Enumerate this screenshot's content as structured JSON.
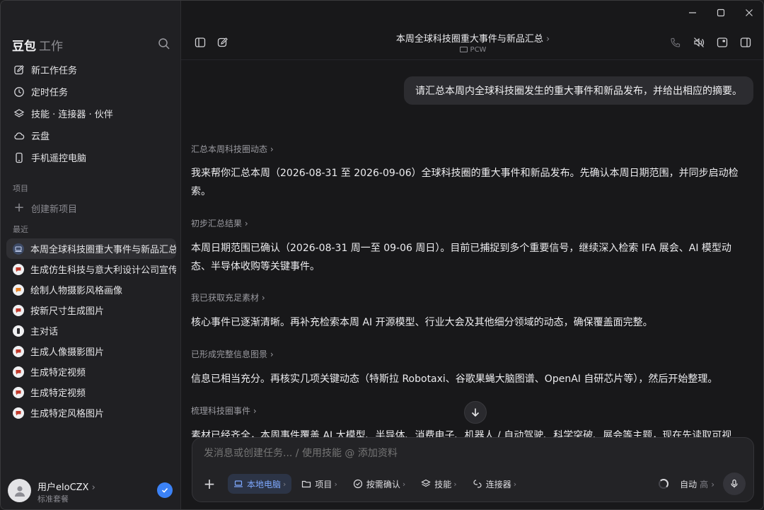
{
  "sidebar": {
    "brand": "豆包",
    "brand_sub": "工作",
    "menu": [
      {
        "label": "新工作任务"
      },
      {
        "label": "定时任务"
      },
      {
        "label": "技能 · 连接器 · 伙伴"
      },
      {
        "label": "云盘"
      },
      {
        "label": "手机遥控电脑"
      }
    ],
    "projects_label": "项目",
    "new_project": "创建新项目",
    "recent_label": "最近",
    "recent": [
      {
        "label": "本周全球科技圈重大事件与新品汇总"
      },
      {
        "label": "生成仿生科技与意大利设计公司宣传"
      },
      {
        "label": "绘制人物摄影风格画像"
      },
      {
        "label": "按新尺寸生成图片"
      },
      {
        "label": "主对话"
      },
      {
        "label": "生成人像摄影图片"
      },
      {
        "label": "生成特定视频"
      },
      {
        "label": "生成特定视频"
      },
      {
        "label": "生成特定风格图片"
      }
    ],
    "user": {
      "name": "用户eloCZX",
      "plan": "标准套餐"
    }
  },
  "header": {
    "title": "本周全球科技圈重大事件与新品汇总",
    "subtitle": "PCW"
  },
  "conversation": {
    "user_message": "请汇总本周内全球科技圈发生的重大事件和新品发布，并给出相应的摘要。",
    "steps": [
      {
        "title": "汇总本周科技圈动态",
        "text": "我来帮你汇总本周（2026-08-31 至 2026-09-06）全球科技圈的重大事件和新品发布。先确认本周日期范围，并同步启动检索。"
      },
      {
        "title": "初步汇总结果",
        "text": "本周日期范围已确认（2026-08-31 周一至 09-06 周日）。目前已捕捉到多个重要信号，继续深入检索 IFA 展会、AI 模型动态、半导体收购等关键事件。"
      },
      {
        "title": "我已获取充足素材",
        "text": "核心事件已逐渐清晰。再补充检索本周 AI 开源模型、行业大会及其他细分领域的动态，确保覆盖面完整。"
      },
      {
        "title": "已形成完整信息图景",
        "text": "信息已相当充分。再核实几项关键动态（特斯拉 Robotaxi、谷歌果蝇大脑图谱、OpenAI 自研芯片等），然后开始整理。"
      },
      {
        "title": "梳理科技圈事件",
        "text": "素材已经齐全，本周事件覆盖 AI 大模型、半导体、消费电子、机器人 / 自动驾驶、科学突破、展会等主题，现在先读取可视"
      }
    ]
  },
  "composer": {
    "placeholder": "发消息或创建任务... / 使用技能 @ 添加资料",
    "chips": [
      {
        "label": "本地电脑"
      },
      {
        "label": "项目"
      },
      {
        "label": "按需确认"
      },
      {
        "label": "技能"
      },
      {
        "label": "连接器"
      }
    ],
    "mode": "自动",
    "level": "高"
  }
}
